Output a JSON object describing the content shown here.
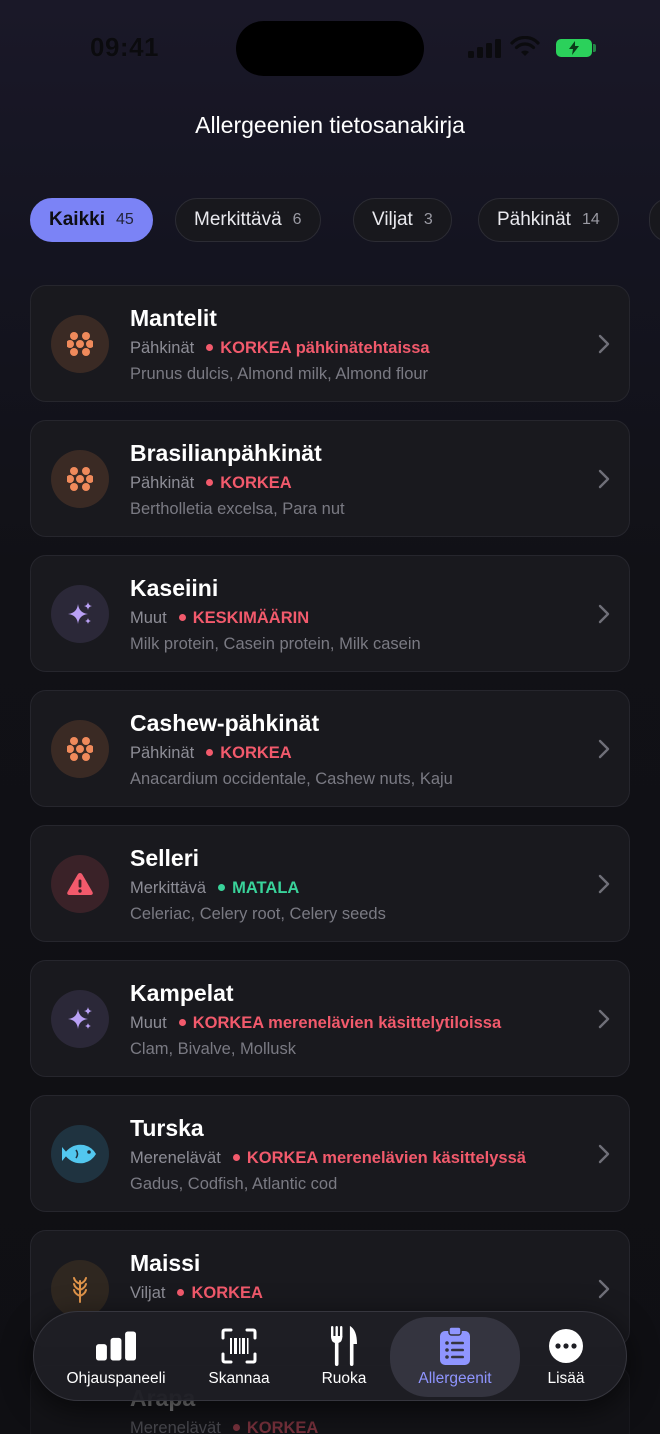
{
  "status": {
    "time": "09:41"
  },
  "header": {
    "title": "Allergeenien tietosanakirja"
  },
  "filters": [
    {
      "label": "Kaikki",
      "count": "45"
    },
    {
      "label": "Merkittävä",
      "count": "6"
    },
    {
      "label": "Viljat",
      "count": "3"
    },
    {
      "label": "Pähkinät",
      "count": "14"
    }
  ],
  "colors": {
    "accent": "#7b83f6",
    "high": "#f25a6c",
    "low": "#39d39a"
  },
  "allergens": [
    {
      "name": "Mantelit",
      "category": "Pähkinät",
      "level": "KORKEA pähkinätehtaissa",
      "aliases": "Prunus dulcis, Almond milk, Almond flour",
      "icon": "nut-cluster-icon"
    },
    {
      "name": "Brasilianpähkinät",
      "category": "Pähkinät",
      "level": "KORKEA",
      "aliases": "Bertholletia excelsa, Para nut",
      "icon": "nut-cluster-icon"
    },
    {
      "name": "Kaseiini",
      "category": "Muut",
      "level": "KESKIMÄÄRIN",
      "aliases": "Milk protein, Casein protein, Milk casein",
      "icon": "sparkle-icon"
    },
    {
      "name": "Cashew-pähkinät",
      "category": "Pähkinät",
      "level": "KORKEA",
      "aliases": "Anacardium occidentale, Cashew nuts, Kaju",
      "icon": "nut-cluster-icon"
    },
    {
      "name": "Selleri",
      "category": "Merkittävä",
      "level": "MATALA",
      "aliases": "Celeriac, Celery root, Celery seeds",
      "icon": "warning-icon"
    },
    {
      "name": "Kampelat",
      "category": "Muut",
      "level": "KORKEA merenelävien käsittelytiloissa",
      "aliases": "Clam, Bivalve, Mollusk",
      "icon": "sparkle-icon"
    },
    {
      "name": "Turska",
      "category": "Merenelävät",
      "level": "KORKEA merenelävien käsittelyssä",
      "aliases": "Gadus, Codfish, Atlantic cod",
      "icon": "fish-icon"
    },
    {
      "name": "Maissi",
      "category": "Viljat",
      "level": "KORKEA",
      "aliases": "",
      "icon": "wheat-icon"
    }
  ],
  "partial_row": {
    "name": "Arapa",
    "category": "Merenelävät",
    "level": "KORKEA"
  },
  "tabbar": [
    {
      "label": "Ohjauspaneeli",
      "icon": "chart-bars-icon"
    },
    {
      "label": "Skannaa",
      "icon": "barcode-scan-icon"
    },
    {
      "label": "Ruoka",
      "icon": "fork-knife-icon"
    },
    {
      "label": "Allergeenit",
      "icon": "clipboard-list-icon"
    },
    {
      "label": "Lisää",
      "icon": "more-dots-icon"
    }
  ]
}
